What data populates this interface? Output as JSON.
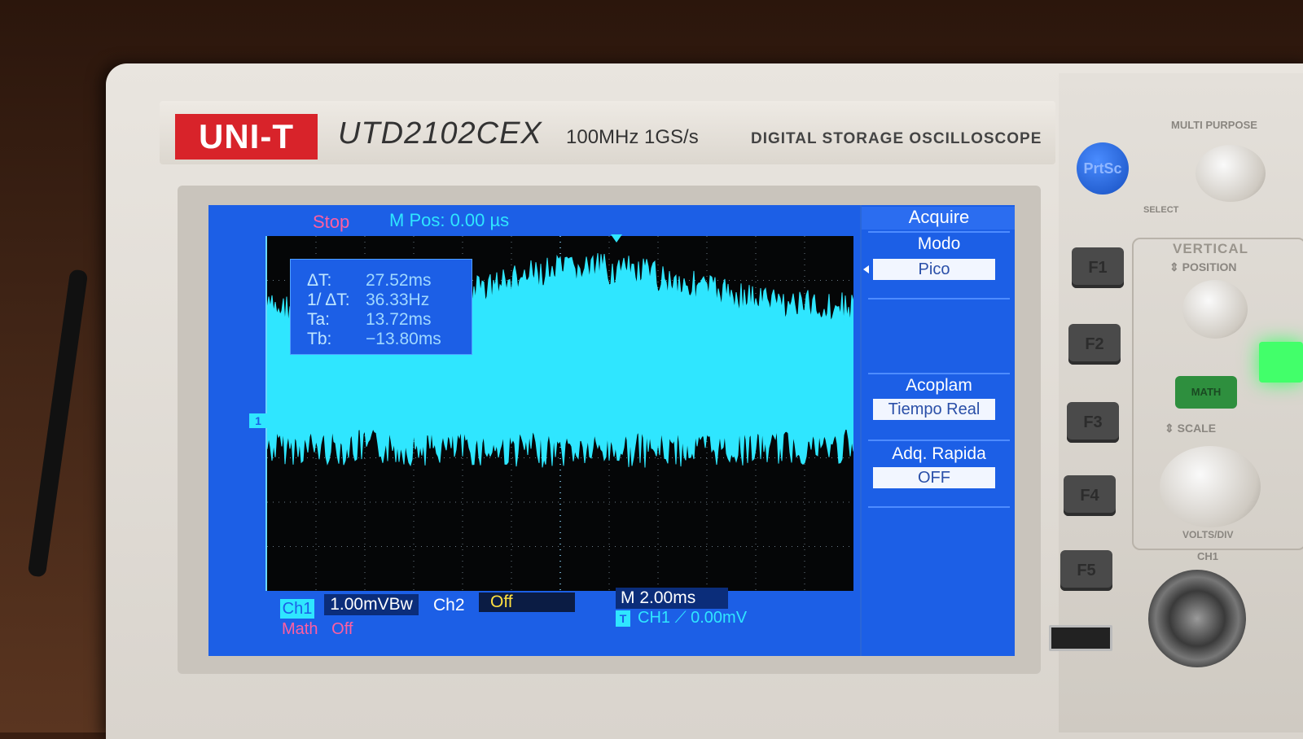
{
  "device": {
    "brand": "UNI-T",
    "model": "UTD2102CEX",
    "specs": "100MHz  1GS/s",
    "type": "DIGITAL STORAGE OSCILLOSCOPE"
  },
  "screen": {
    "status": "Stop",
    "mpos": "M Pos: 0.00 µs",
    "measurements": [
      {
        "label": "ΔT:",
        "value": "27.52ms"
      },
      {
        "label": "1/ ΔT:",
        "value": "36.33Hz"
      },
      {
        "label": "Ta:",
        "value": "13.72ms"
      },
      {
        "label": "Tb:",
        "value": "−13.80ms"
      }
    ],
    "channel_marker": "1",
    "menu": {
      "title": "Acquire",
      "modo_label": "Modo",
      "modo_value": "Pico",
      "acoplam_label": "Acoplam",
      "acoplam_value": "Tiempo Real",
      "adq_label": "Adq. Rapida",
      "adq_value": "OFF"
    },
    "bottom": {
      "ch1_label": "Ch1",
      "ch1_value": "1.00mVBw",
      "ch2_label": "Ch2",
      "ch2_value": "Off",
      "timebase": "M 2.00ms",
      "trigger_badge": "T",
      "trigger_text": "CH1  ⟋  0.00mV",
      "math_label": "Math",
      "math_value": "Off"
    },
    "colors": {
      "screen_bg": "#1c5fe6",
      "trace": "#2fe6ff",
      "grid_bg": "#050607",
      "status": "#ff5fa0",
      "ch2": "#ffe040"
    }
  },
  "panel": {
    "prtsc": "PrtSc",
    "multipurpose": "MULTI PURPOSE",
    "select": "SELECT",
    "vertical": "VERTICAL",
    "position": "⇕ POSITION",
    "math": "MATH",
    "scale": "⇕ SCALE",
    "volts_div": "VOLTS/DIV",
    "ch1": "CH1",
    "fkeys": [
      "F1",
      "F2",
      "F3",
      "F4",
      "F5"
    ]
  }
}
